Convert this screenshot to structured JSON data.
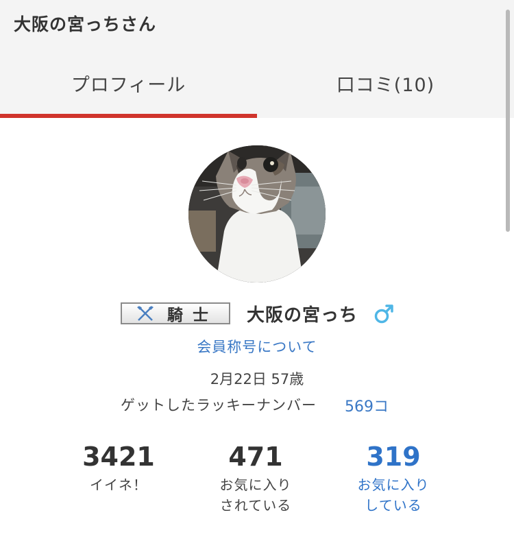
{
  "header": {
    "title": "大阪の宮っちさん"
  },
  "tabs": [
    {
      "label": "プロフィール",
      "active": true
    },
    {
      "label": "口コミ(10)",
      "active": false
    }
  ],
  "profile": {
    "avatar_icon": "cat-photo-avatar",
    "rank_badge": "騎士",
    "rank_icon": "crossed-axes-icon",
    "username": "大阪の宮っち",
    "gender_icon": "male-symbol-icon",
    "member_title_link": "会員称号について",
    "birthday_age": "2月22日 57歳",
    "lucky_number_label": "ゲットしたラッキーナンバー",
    "lucky_number_count": "569コ"
  },
  "stats": [
    {
      "number": "3421",
      "label_line1": "イイネ！",
      "label_line2": ""
    },
    {
      "number": "471",
      "label_line1": "お気に入り",
      "label_line2": "されている"
    },
    {
      "number": "319",
      "label_line1": "お気に入り",
      "label_line2": "している"
    }
  ],
  "colors": {
    "accent_red": "#d0342c",
    "link_blue": "#3a78c5",
    "male_blue": "#4fb6e6",
    "header_bg": "#f4f4f4"
  }
}
